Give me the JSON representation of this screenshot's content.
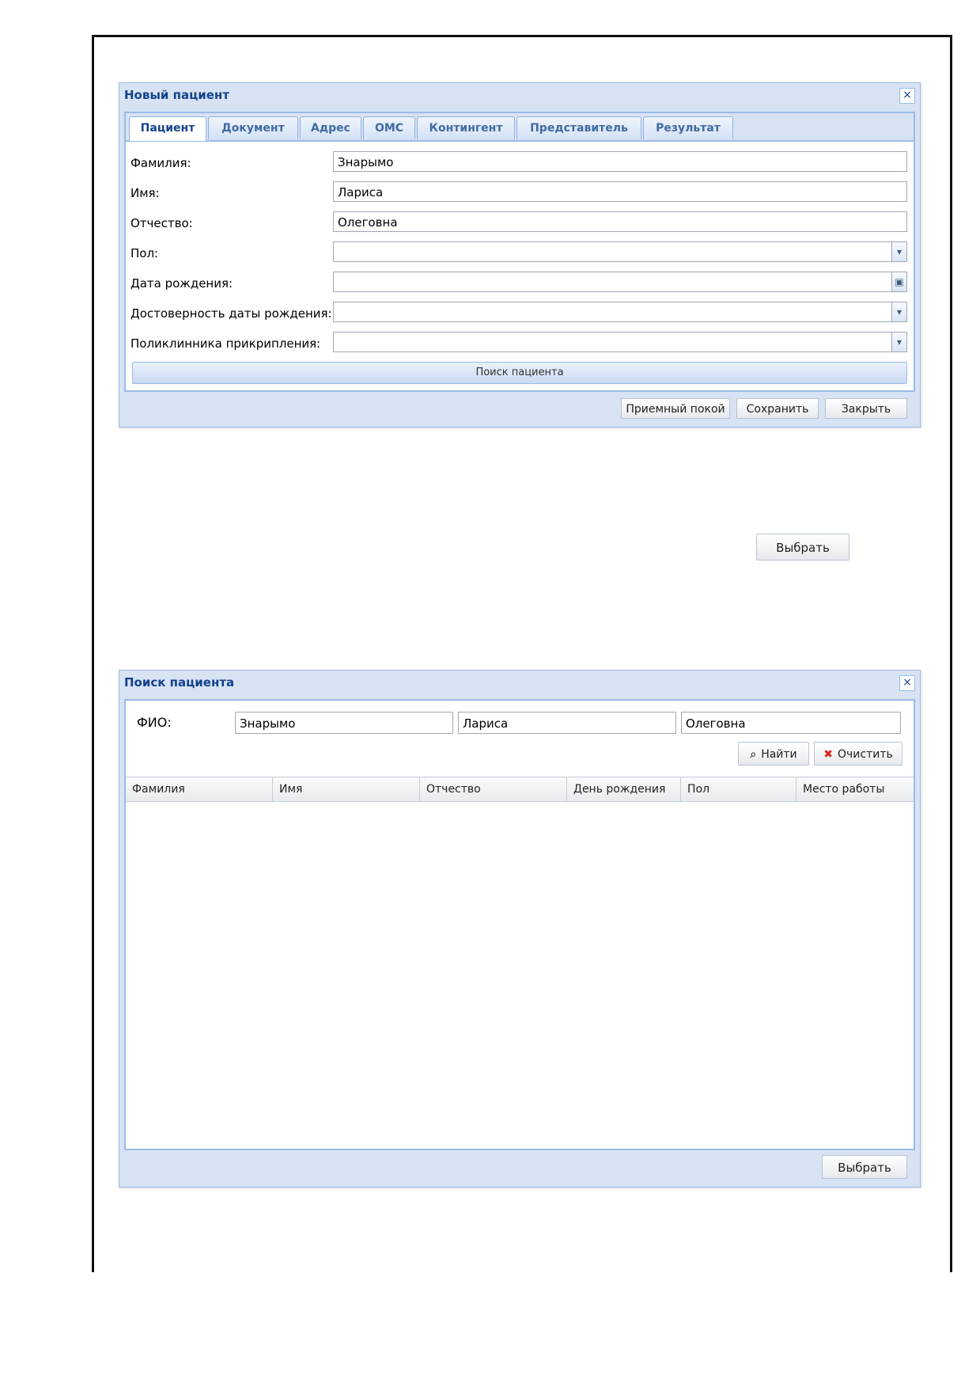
{
  "new_patient_window": {
    "title": "Новый пациент",
    "close_icon": "×",
    "tabs": [
      {
        "label": "Пациент"
      },
      {
        "label": "Документ"
      },
      {
        "label": "Адрес"
      },
      {
        "label": "ОМС"
      },
      {
        "label": "Контингент"
      },
      {
        "label": "Представитель"
      },
      {
        "label": "Результат"
      }
    ],
    "active_tab": "Пациент",
    "fields": [
      {
        "label": "Фамилия:",
        "value": "Знарымо"
      },
      {
        "label": "Имя:",
        "value": "Лариса"
      },
      {
        "label": "Отчество:",
        "value": "Олеговна"
      },
      {
        "label": "Пол:",
        "value": ""
      },
      {
        "label": "Дата рождения:",
        "value": ""
      },
      {
        "label": "Достоверность даты рождения:",
        "value": ""
      },
      {
        "label": "Поликлинника прикрипления:",
        "value": ""
      }
    ],
    "search_button": "Поиск пациента",
    "footer_buttons": {
      "reception": "Приемный покой",
      "save": "Сохранить",
      "close": "Закрыть"
    }
  },
  "standalone_select_button": "Выбрать",
  "search_window": {
    "title": "Поиск пациента",
    "close_icon": "×",
    "fio_label": "ФИО:",
    "fio": {
      "last_name": "Знарымо",
      "first_name": "Лариса",
      "middle_name": "Олеговна"
    },
    "find_button": "Найти",
    "clear_button": "Очистить",
    "columns": [
      "Фамилия",
      "Имя",
      "Отчество",
      "День рождения",
      "Пол",
      "Место работы"
    ],
    "select_button": "Выбрать"
  },
  "icons": {
    "dropdown": "▾",
    "calendar": "▣",
    "find": "⌕",
    "clear": "✖"
  },
  "colors": {
    "title_text": "#15428b",
    "window_bg": "#d7e3f3",
    "border": "#99bbe8",
    "clear_icon": "#d9261c"
  }
}
